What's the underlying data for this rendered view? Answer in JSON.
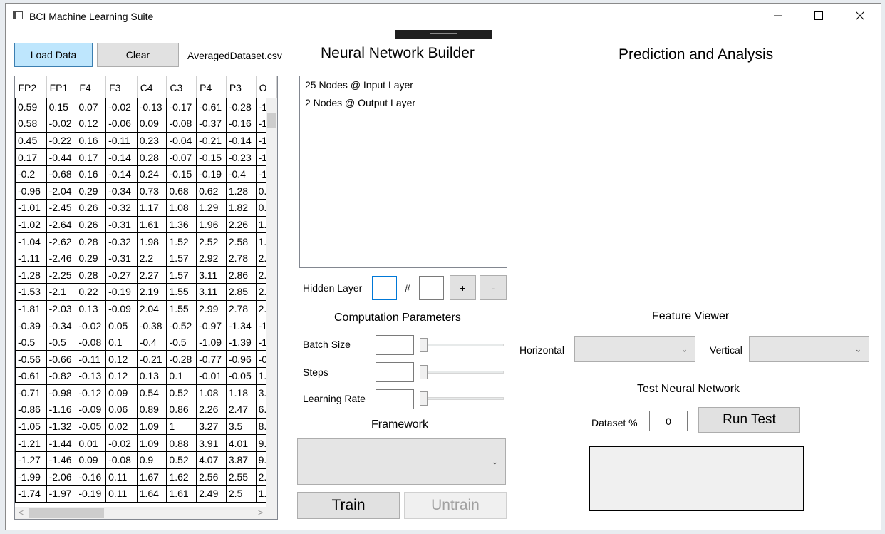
{
  "window": {
    "title": "BCI Machine Learning Suite"
  },
  "toolbar": {
    "load_label": "Load Data",
    "clear_label": "Clear",
    "filename": "AveragedDataset.csv"
  },
  "table": {
    "columns": [
      "FP2",
      "FP1",
      "F4",
      "F3",
      "C4",
      "C3",
      "P4",
      "P3",
      "O"
    ],
    "rows": [
      [
        "0.59",
        "0.15",
        "0.07",
        "-0.02",
        "-0.13",
        "-0.17",
        "-0.61",
        "-0.28",
        "-1"
      ],
      [
        "0.58",
        "-0.02",
        "0.12",
        "-0.06",
        "0.09",
        "-0.08",
        "-0.37",
        "-0.16",
        "-1"
      ],
      [
        "0.45",
        "-0.22",
        "0.16",
        "-0.11",
        "0.23",
        "-0.04",
        "-0.21",
        "-0.14",
        "-1"
      ],
      [
        "0.17",
        "-0.44",
        "0.17",
        "-0.14",
        "0.28",
        "-0.07",
        "-0.15",
        "-0.23",
        "-1"
      ],
      [
        "-0.2",
        "-0.68",
        "0.16",
        "-0.14",
        "0.24",
        "-0.15",
        "-0.19",
        "-0.4",
        "-1"
      ],
      [
        "-0.96",
        "-2.04",
        "0.29",
        "-0.34",
        "0.73",
        "0.68",
        "0.62",
        "1.28",
        "0."
      ],
      [
        "-1.01",
        "-2.45",
        "0.26",
        "-0.32",
        "1.17",
        "1.08",
        "1.29",
        "1.82",
        "0."
      ],
      [
        "-1.02",
        "-2.64",
        "0.26",
        "-0.31",
        "1.61",
        "1.36",
        "1.96",
        "2.26",
        "1."
      ],
      [
        "-1.04",
        "-2.62",
        "0.28",
        "-0.32",
        "1.98",
        "1.52",
        "2.52",
        "2.58",
        "1."
      ],
      [
        "-1.11",
        "-2.46",
        "0.29",
        "-0.31",
        "2.2",
        "1.57",
        "2.92",
        "2.78",
        "2."
      ],
      [
        "-1.28",
        "-2.25",
        "0.28",
        "-0.27",
        "2.27",
        "1.57",
        "3.11",
        "2.86",
        "2."
      ],
      [
        "-1.53",
        "-2.1",
        "0.22",
        "-0.19",
        "2.19",
        "1.55",
        "3.11",
        "2.85",
        "2."
      ],
      [
        "-1.81",
        "-2.03",
        "0.13",
        "-0.09",
        "2.04",
        "1.55",
        "2.99",
        "2.78",
        "2."
      ],
      [
        "-0.39",
        "-0.34",
        "-0.02",
        "0.05",
        "-0.38",
        "-0.52",
        "-0.97",
        "-1.34",
        "-1"
      ],
      [
        "-0.5",
        "-0.5",
        "-0.08",
        "0.1",
        "-0.4",
        "-0.5",
        "-1.09",
        "-1.39",
        "-1"
      ],
      [
        "-0.56",
        "-0.66",
        "-0.11",
        "0.12",
        "-0.21",
        "-0.28",
        "-0.77",
        "-0.96",
        "-0"
      ],
      [
        "-0.61",
        "-0.82",
        "-0.13",
        "0.12",
        "0.13",
        "0.1",
        "-0.01",
        "-0.05",
        "1."
      ],
      [
        "-0.71",
        "-0.98",
        "-0.12",
        "0.09",
        "0.54",
        "0.52",
        "1.08",
        "1.18",
        "3."
      ],
      [
        "-0.86",
        "-1.16",
        "-0.09",
        "0.06",
        "0.89",
        "0.86",
        "2.26",
        "2.47",
        "6."
      ],
      [
        "-1.05",
        "-1.32",
        "-0.05",
        "0.02",
        "1.09",
        "1",
        "3.27",
        "3.5",
        "8."
      ],
      [
        "-1.21",
        "-1.44",
        "0.01",
        "-0.02",
        "1.09",
        "0.88",
        "3.91",
        "4.01",
        "9."
      ],
      [
        "-1.27",
        "-1.46",
        "0.09",
        "-0.08",
        "0.9",
        "0.52",
        "4.07",
        "3.87",
        "9."
      ],
      [
        "-1.99",
        "-2.06",
        "-0.16",
        "0.11",
        "1.67",
        "1.62",
        "2.56",
        "2.55",
        "2."
      ],
      [
        "-1.74",
        "-1.97",
        "-0.19",
        "0.11",
        "1.64",
        "1.61",
        "2.49",
        "2.5",
        "1."
      ]
    ]
  },
  "builder": {
    "title": "Neural Network Builder",
    "layers": [
      "25 Nodes @ Input Layer",
      "2 Nodes @ Output Layer"
    ],
    "hidden_layer_label": "Hidden Layer",
    "hash_label": "#",
    "hidden_layer_value": "",
    "node_count_value": "",
    "add_label": "+",
    "remove_label": "-"
  },
  "params": {
    "title": "Computation Parameters",
    "batch_size_label": "Batch Size",
    "steps_label": "Steps",
    "learning_rate_label": "Learning Rate",
    "batch_size_value": "",
    "steps_value": "",
    "learning_rate_value": "",
    "slider_levels": {
      "batch_size": 0,
      "steps": 0,
      "learning_rate": 0
    }
  },
  "framework": {
    "title": "Framework",
    "selected": ""
  },
  "actions": {
    "train_label": "Train",
    "untrain_label": "Untrain"
  },
  "analysis": {
    "title": "Prediction and Analysis",
    "feature_viewer_title": "Feature Viewer",
    "horizontal_label": "Horizontal",
    "vertical_label": "Vertical",
    "horizontal_selected": "",
    "vertical_selected": "",
    "test_title": "Test Neural Network",
    "dataset_pct_label": "Dataset %",
    "dataset_pct_value": "0",
    "run_test_label": "Run Test",
    "result_text": ""
  },
  "icons": {
    "app": "window-app-icon",
    "minimize": "minimize-icon",
    "maximize": "maximize-icon",
    "close": "close-icon",
    "dropdown": "chevron-down-icon"
  },
  "colors": {
    "primary_button": "#bee6fd",
    "button": "#e1e1e1",
    "disabled_text": "#a0a0a0"
  }
}
